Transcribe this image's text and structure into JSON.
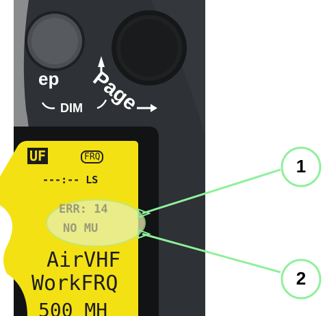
{
  "device": {
    "button_label_partial": "ep",
    "knob_label": "Page",
    "dim_label": "DIM",
    "colors": {
      "bezel": "#2d3034",
      "lcd": "#f3e114",
      "lcd_text": "#1d1d1d",
      "callout": "#8ff09a"
    }
  },
  "lcd": {
    "mode_text": "UF",
    "mode_box": "FRQ",
    "time_row": "---:-- LS",
    "freq_error": "ERR: 14",
    "status": "NO MU",
    "line_air": "AirVHF",
    "line_work": "WorkFRQ",
    "line_partial": "500 MH"
  },
  "callouts": [
    {
      "number": "1"
    },
    {
      "number": "2"
    }
  ]
}
